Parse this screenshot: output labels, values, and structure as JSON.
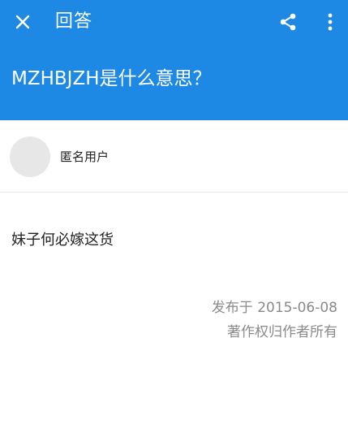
{
  "header": {
    "title": "回答",
    "question": "MZHBJZH是什么意思？",
    "icons": {
      "close": "close-icon",
      "share": "share-icon",
      "more": "more-vertical-icon"
    },
    "colors": {
      "primary": "#1e88e5",
      "on_primary": "#ffffff"
    }
  },
  "author": {
    "name": "匿名用户"
  },
  "answer": {
    "body": "妹子何必嫁这货"
  },
  "meta": {
    "published": "发布于 2015-06-08",
    "copyright": "著作权归作者所有"
  }
}
